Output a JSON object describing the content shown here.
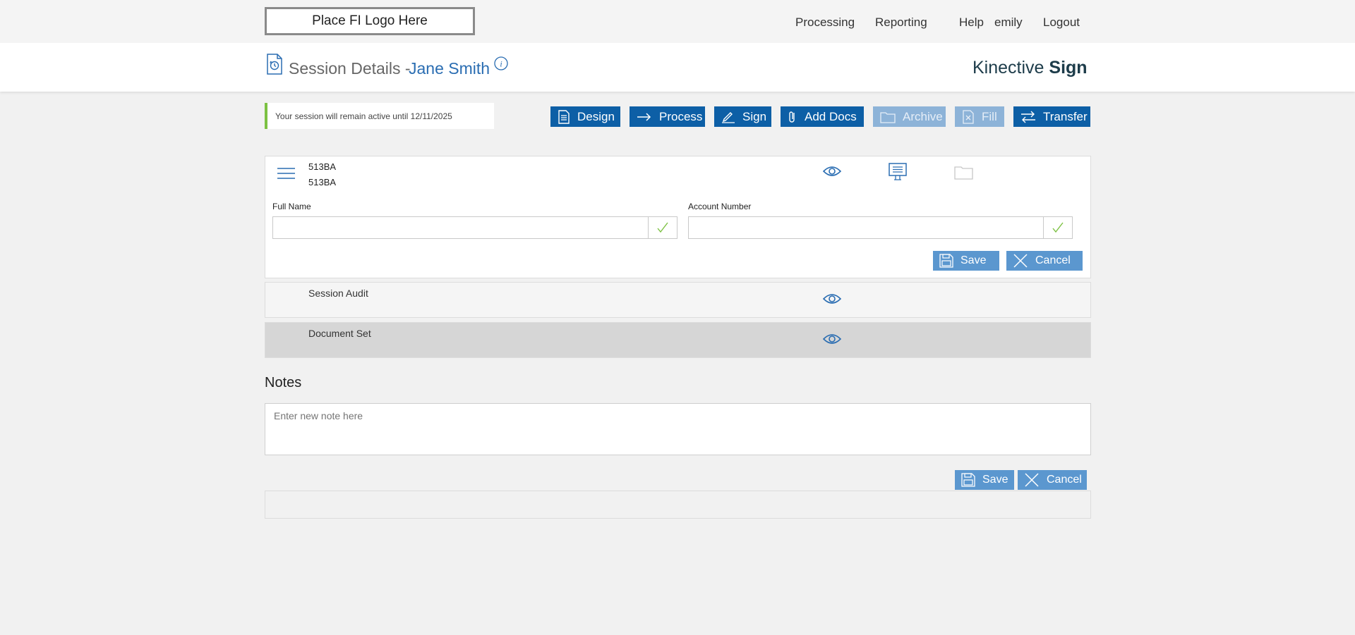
{
  "top_nav": {
    "logo_text": "Place FI Logo Here",
    "items": [
      "Processing",
      "Reporting",
      "Help",
      "emily",
      "Logout"
    ]
  },
  "header": {
    "title": "Session Details -",
    "name": "Jane Smith",
    "brand_light": "Kinective",
    "brand_bold": "Sign"
  },
  "notice": {
    "text": "Your session will remain active until 12/11/2025"
  },
  "toolbar": {
    "design": "Design",
    "process": "Process",
    "sign": "Sign",
    "add_docs": "Add Docs",
    "archive": "Archive",
    "fill": "Fill",
    "transfer": "Transfer"
  },
  "document": {
    "line1": "513BA",
    "line2": "513BA",
    "full_name_label": "Full Name",
    "full_name_value": "",
    "account_number_label": "Account Number",
    "account_number_value": "",
    "save": "Save",
    "cancel": "Cancel"
  },
  "rows": {
    "session_audit": "Session Audit",
    "document_set": "Document Set"
  },
  "notes": {
    "title": "Notes",
    "placeholder": "Enter new note here",
    "save": "Save",
    "cancel": "Cancel"
  },
  "colors": {
    "primary": "#0d5fa6",
    "primary_disabled": "#8db3d8",
    "secondary_button": "#5b97cf",
    "link_blue": "#2a6db2",
    "notice_accent": "#7cc142",
    "check_green": "#7cc142"
  }
}
